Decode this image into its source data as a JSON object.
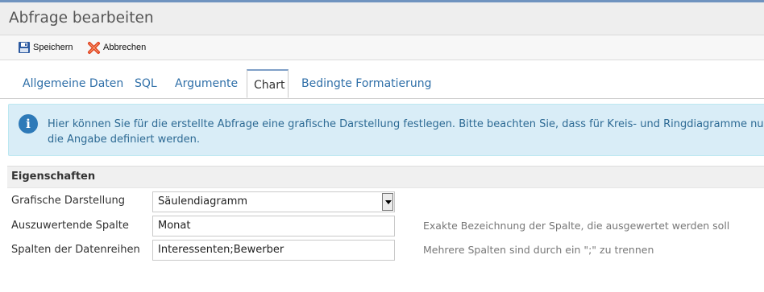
{
  "header": {
    "title": "Abfrage bearbeiten"
  },
  "toolbar": {
    "save_label": "Speichern",
    "cancel_label": "Abbrechen"
  },
  "tabs": [
    {
      "label": "Allgemeine Daten",
      "active": false
    },
    {
      "label": "SQL",
      "active": false
    },
    {
      "label": "Argumente",
      "active": false
    },
    {
      "label": "Chart",
      "active": true
    },
    {
      "label": "Bedingte Formatierung",
      "active": false
    }
  ],
  "info": {
    "text": "Hier können Sie für die erstellte Abfrage eine grafische Darstellung festlegen. Bitte beachten Sie, dass für Kreis- und Ringdiagramme nur die Angabe definiert werden."
  },
  "section": {
    "title": "Eigenschaften"
  },
  "form": {
    "chart_type_label": "Grafische Darstellung",
    "chart_type_value": "Säulendiagramm",
    "column_label": "Auszuwertende Spalte",
    "column_value": "Monat",
    "column_hint": "Exakte Bezeichnung der Spalte, die ausgewertet werden soll",
    "series_label": "Spalten der Datenreihen",
    "series_value": "Interessenten;Bewerber",
    "series_hint": "Mehrere Spalten sind durch ein \";\" zu trennen"
  },
  "colors": {
    "accent": "#6f93bf",
    "info_bg": "#d9edf7",
    "info_text": "#2d6a94",
    "link": "#2f6fa8"
  },
  "icons": {
    "save": "floppy-disk-icon",
    "cancel": "red-x-icon",
    "info": "info-circle-icon"
  }
}
